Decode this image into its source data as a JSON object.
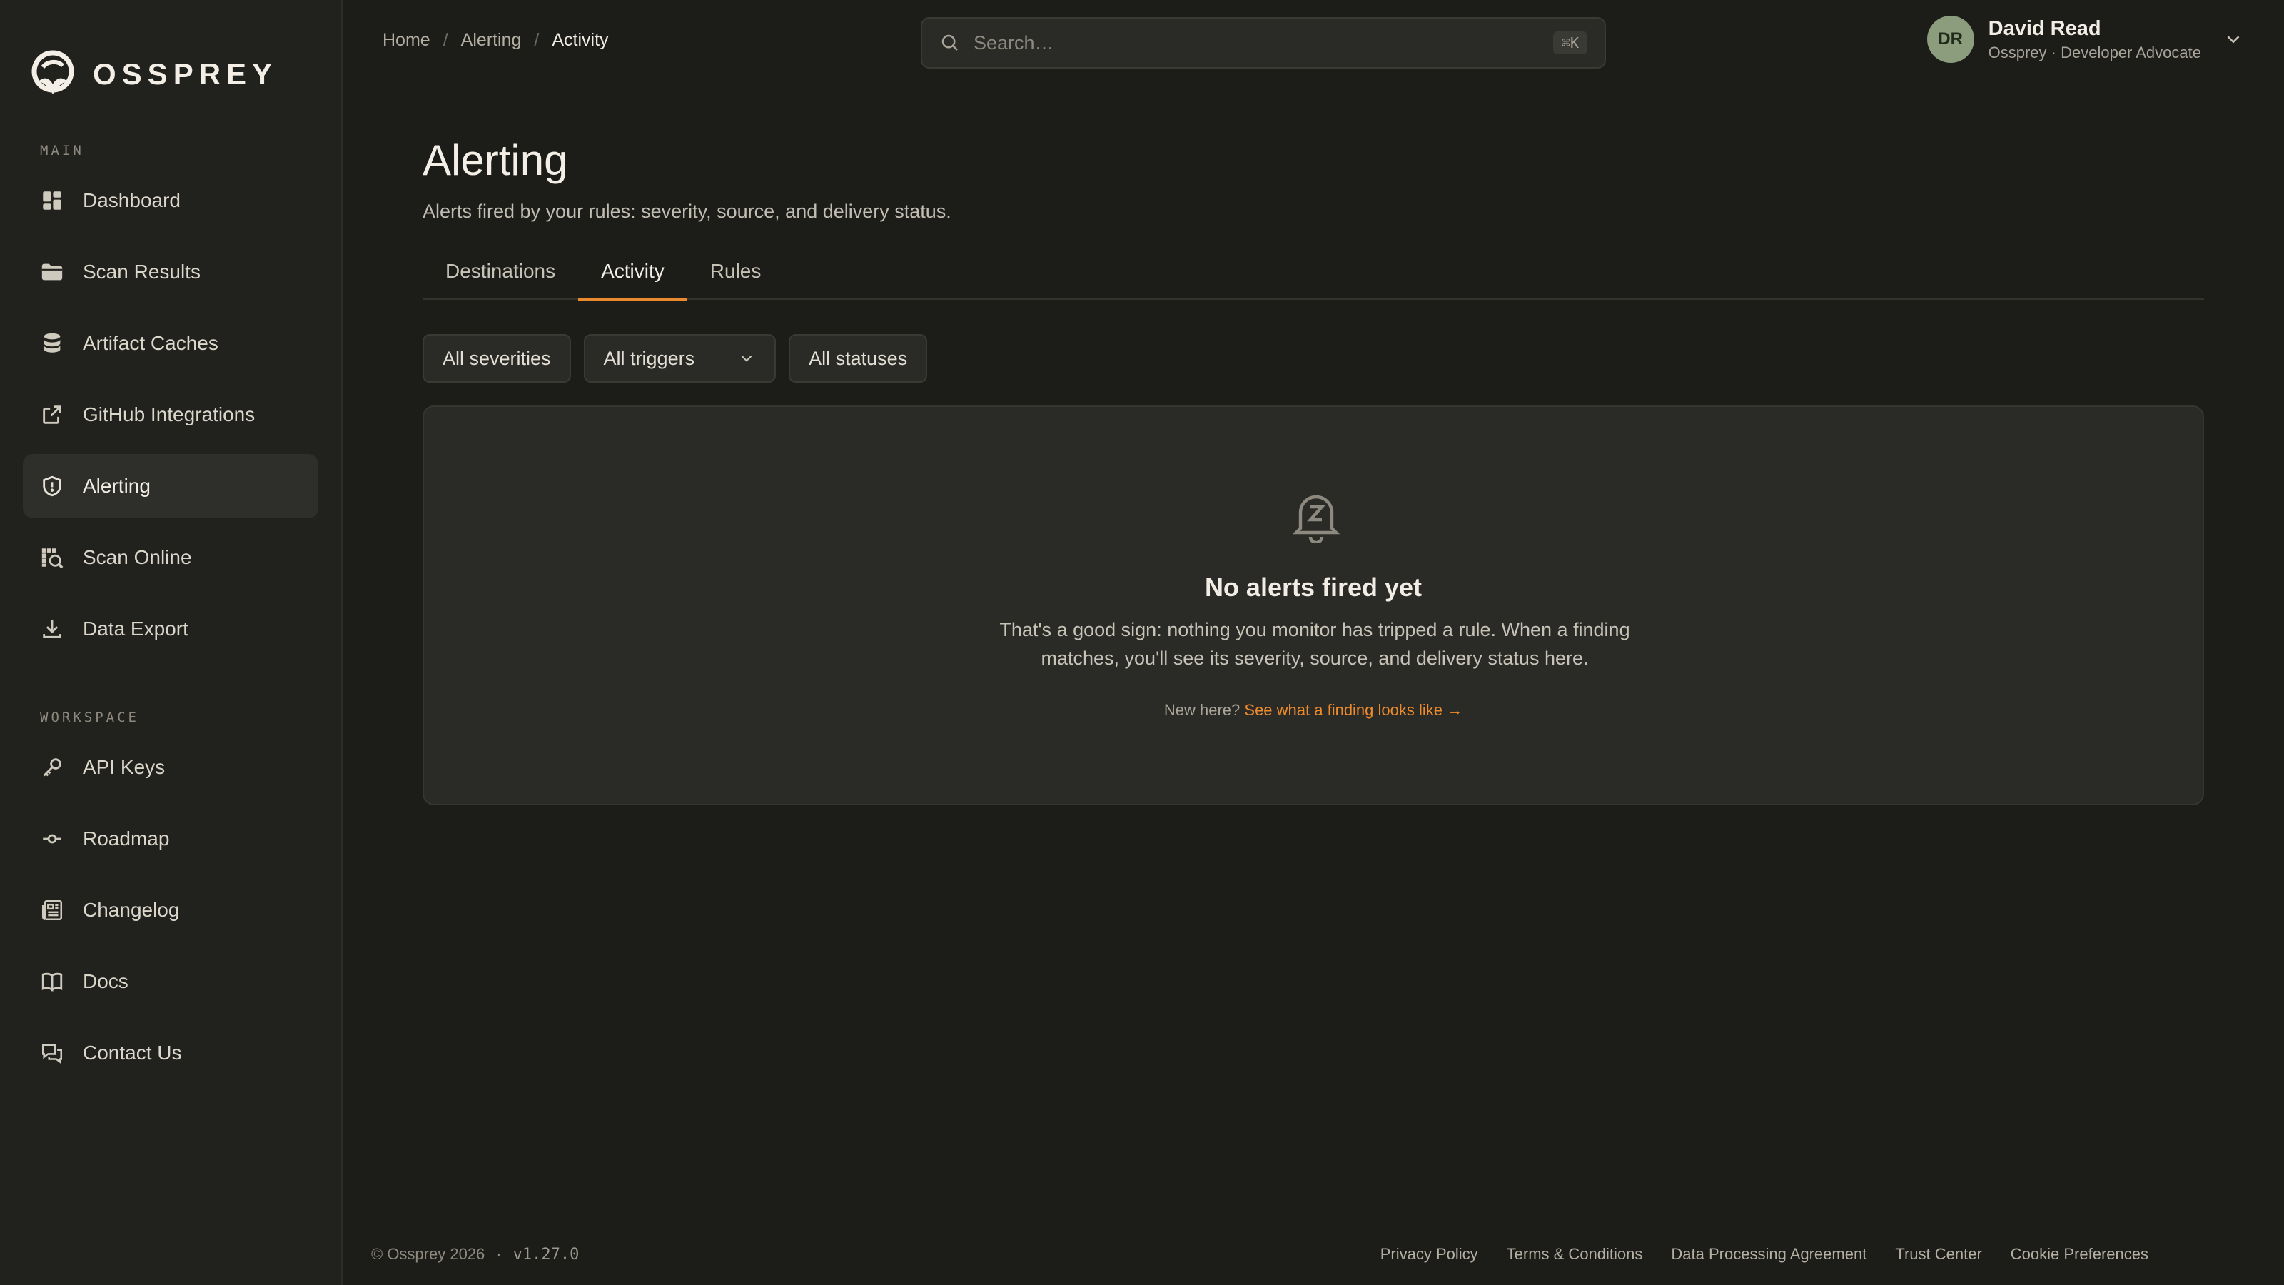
{
  "brand": {
    "name": "OSSPREY"
  },
  "sidebar": {
    "main_label": "MAIN",
    "workspace_label": "WORKSPACE",
    "main_items": [
      {
        "label": "Dashboard",
        "icon": "dashboard-icon"
      },
      {
        "label": "Scan Results",
        "icon": "folder-icon"
      },
      {
        "label": "Artifact Caches",
        "icon": "database-icon"
      },
      {
        "label": "GitHub Integrations",
        "icon": "external-link-icon"
      },
      {
        "label": "Alerting",
        "icon": "shield-icon",
        "active": true
      },
      {
        "label": "Scan Online",
        "icon": "scan-icon"
      },
      {
        "label": "Data Export",
        "icon": "download-icon"
      }
    ],
    "workspace_items": [
      {
        "label": "API Keys",
        "icon": "key-icon"
      },
      {
        "label": "Roadmap",
        "icon": "commit-icon"
      },
      {
        "label": "Changelog",
        "icon": "newspaper-icon"
      },
      {
        "label": "Docs",
        "icon": "book-icon"
      },
      {
        "label": "Contact Us",
        "icon": "chat-icon"
      }
    ]
  },
  "breadcrumb": {
    "home": "Home",
    "section": "Alerting",
    "current": "Activity",
    "separator": "/"
  },
  "search": {
    "placeholder": "Search…",
    "shortcut": "⌘K"
  },
  "user": {
    "initials": "DR",
    "name": "David Read",
    "role": "Ossprey · Developer Advocate"
  },
  "page": {
    "title": "Alerting",
    "subtitle": "Alerts fired by your rules: severity, source, and delivery status."
  },
  "tabs": [
    {
      "label": "Destinations"
    },
    {
      "label": "Activity",
      "active": true
    },
    {
      "label": "Rules"
    }
  ],
  "filters": {
    "severity": "All severities",
    "trigger": "All triggers",
    "status": "All statuses"
  },
  "empty_state": {
    "title": "No alerts fired yet",
    "description": "That's a good sign: nothing you monitor has tripped a rule. When a finding matches, you'll see its severity, source, and delivery status here.",
    "hint_prefix": "New here?",
    "hint_link": "See what a finding looks like →"
  },
  "footer": {
    "copyright": "© Ossprey 2026",
    "dot": "·",
    "version": "v1.27.0",
    "links": [
      "Privacy Policy",
      "Terms & Conditions",
      "Data Processing Agreement",
      "Trust Center",
      "Cookie Preferences"
    ]
  },
  "colors": {
    "accent": "#e98a2f",
    "background": "#1c1c19",
    "sidebar": "#21211d",
    "card": "#2a2a26",
    "avatar": "#8b9d7d"
  }
}
